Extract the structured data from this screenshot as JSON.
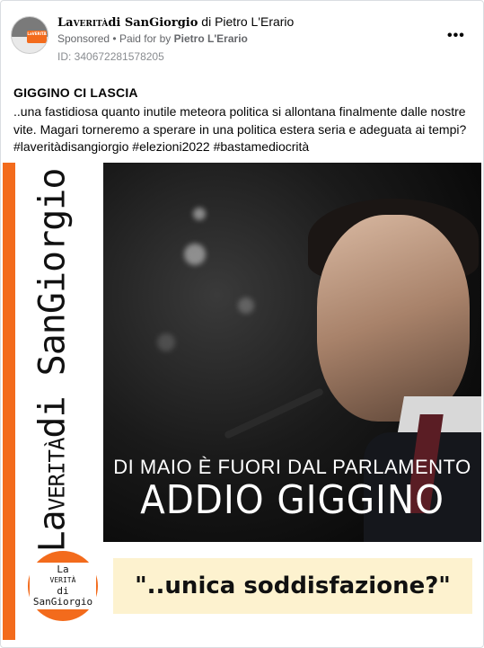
{
  "header": {
    "page_name": "LaVERITÀdi SanGiorgio",
    "page_name_prefix": "La",
    "page_name_caps": "VERITÀ",
    "page_name_suffix": "di SanGiorgio",
    "by_text": "di Pietro L'Erario",
    "sponsored_label": "Sponsored",
    "separator": "•",
    "paid_for_text": "Paid for by",
    "payer_name": "Pietro L'Erario",
    "ad_id": "ID: 340672281578205",
    "more_icon": "more-horizontal-icon",
    "more_label": "•••"
  },
  "post": {
    "title": "GIGGINO CI LASCIA",
    "body": "..una fastidiosa quanto inutile meteora politica si allontana finalmente dalle nostre vite. Magari torneremo a sperare in una politica estera seria e adeguata ai tempi?",
    "hashtags": "#laveritàdisangiorgio #elezioni2022 #bastamediocrità"
  },
  "creative": {
    "vertical_brand_prefix": "La",
    "vertical_brand_caps": "VERITÀ",
    "vertical_brand_suffix": "di SanGiorgio",
    "headline_small": "DI MAIO È FUORI DAL PARLAMENTO",
    "headline_big": "ADDIO GIGGINO",
    "logo_line1_prefix": "La",
    "logo_line1_caps": "VERITÀ",
    "logo_line1_suffix": "di",
    "logo_line2": "SanGiorgio",
    "quote": "\"..unica soddisfazione?\"",
    "accent_color": "#f36b1c",
    "quote_bg_color": "#fdf2cf"
  }
}
